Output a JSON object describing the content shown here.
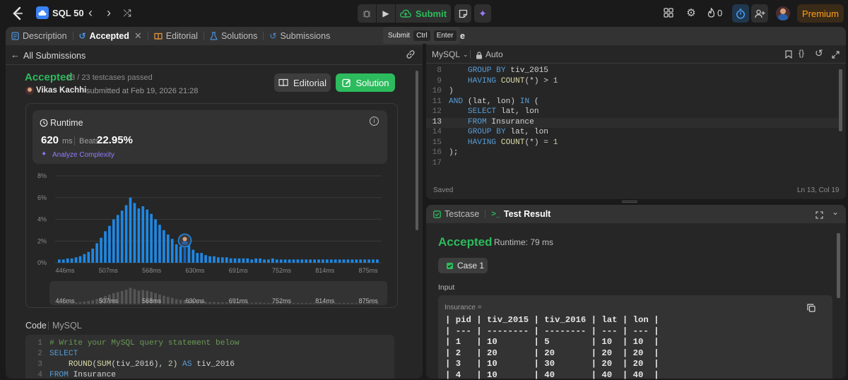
{
  "topbar": {
    "problem_list": "SQL 50",
    "submit_label": "Submit",
    "streak": "0",
    "premium": "Premium"
  },
  "tooltip": {
    "label": "Submit",
    "k1": "Ctrl",
    "k2": "Enter"
  },
  "left_tabs": {
    "description": "Description",
    "accepted": "Accepted",
    "editorial": "Editorial",
    "solutions": "Solutions",
    "submissions": "Submissions"
  },
  "submission": {
    "back": "All Submissions",
    "status": "Accepted",
    "testcases": "23 / 23 testcases passed",
    "user": "Vikas Kachhi",
    "submitted": "submitted at Feb 19, 2026 21:28",
    "editorial_btn": "Editorial",
    "solution_btn": "Solution",
    "runtime_title": "Runtime",
    "runtime_value": "620",
    "runtime_unit": "ms",
    "beats_label": "Beats",
    "beats_value": "22.95%",
    "analyze": "Analyze Complexity"
  },
  "chart_data": {
    "type": "bar",
    "ylabel": "",
    "ylim": [
      0,
      8
    ],
    "yticks": [
      "8%",
      "6%",
      "4%",
      "2%",
      "0%"
    ],
    "xticks": [
      "446ms",
      "507ms",
      "568ms",
      "630ms",
      "691ms",
      "752ms",
      "814ms",
      "875ms"
    ],
    "values": [
      0.3,
      0.3,
      0.4,
      0.4,
      0.5,
      0.6,
      0.8,
      1.0,
      1.3,
      1.8,
      2.3,
      2.9,
      3.4,
      4.0,
      4.4,
      4.8,
      5.3,
      6.0,
      5.5,
      5.0,
      5.2,
      4.9,
      4.5,
      4.0,
      3.5,
      3.0,
      2.6,
      2.2,
      1.7,
      1.5,
      1.4,
      1.6,
      1.2,
      0.9,
      0.9,
      0.7,
      0.6,
      0.6,
      0.5,
      0.5,
      0.5,
      0.4,
      0.4,
      0.4,
      0.4,
      0.4,
      0.3,
      0.4,
      0.4,
      0.3,
      0.3,
      0.4,
      0.3,
      0.3,
      0.3,
      0.3,
      0.3,
      0.3,
      0.3,
      0.3,
      0.3,
      0.3,
      0.3,
      0.3,
      0.3,
      0.3,
      0.3,
      0.3,
      0.3,
      0.3,
      0.3,
      0.3,
      0.3,
      0.3,
      0.3,
      0.3,
      0.3
    ],
    "highlight_index": 30,
    "grid": true
  },
  "code_section": {
    "code_label": "Code",
    "lang": "MySQL",
    "lines": [
      {
        "n": "1",
        "t": "# Write your MySQL query statement below",
        "c": "cm"
      },
      {
        "n": "2",
        "t": "SELECT",
        "c": "kw"
      },
      {
        "n": "3",
        "t": "    ROUND(SUM(tiv_2016), 2) AS tiv_2016",
        "c": "pl"
      },
      {
        "n": "4",
        "t": "FROM Insurance",
        "c": "pl"
      }
    ]
  },
  "editor": {
    "lang": "MySQL",
    "mode": "Auto",
    "saved": "Saved",
    "cursor": "Ln 13, Col 19",
    "lines": [
      {
        "n": "8",
        "t": "    GROUP BY tiv_2015"
      },
      {
        "n": "9",
        "t": "    HAVING COUNT(*) > 1"
      },
      {
        "n": "10",
        "t": ")"
      },
      {
        "n": "11",
        "t": "AND (lat, lon) IN ("
      },
      {
        "n": "12",
        "t": "    SELECT lat, lon"
      },
      {
        "n": "13",
        "t": "    FROM Insurance"
      },
      {
        "n": "14",
        "t": "    GROUP BY lat, lon"
      },
      {
        "n": "15",
        "t": "    HAVING COUNT(*) = 1"
      },
      {
        "n": "16",
        "t": ");"
      },
      {
        "n": "17",
        "t": ""
      }
    ]
  },
  "result": {
    "testcase_tab": "Testcase",
    "result_tab": "Test Result",
    "status": "Accepted",
    "runtime": "Runtime: 79 ms",
    "case": "Case 1",
    "input_label": "Input",
    "table_name": "Insurance =",
    "table_lines": [
      "| pid | tiv_2015 | tiv_2016 | lat | lon |",
      "| --- | -------- | -------- | --- | --- |",
      "| 1   | 10       | 5        | 10  | 10  |",
      "| 2   | 20       | 20       | 20  | 20  |",
      "| 3   | 10       | 30       | 20  | 20  |",
      "| 4   | 10       | 40       | 40  | 40  |"
    ]
  },
  "colors": {
    "accent_green": "#2cbb5d",
    "bar_blue": "#1e88e5",
    "bg": "#1a1a1a",
    "panel": "#262626"
  }
}
